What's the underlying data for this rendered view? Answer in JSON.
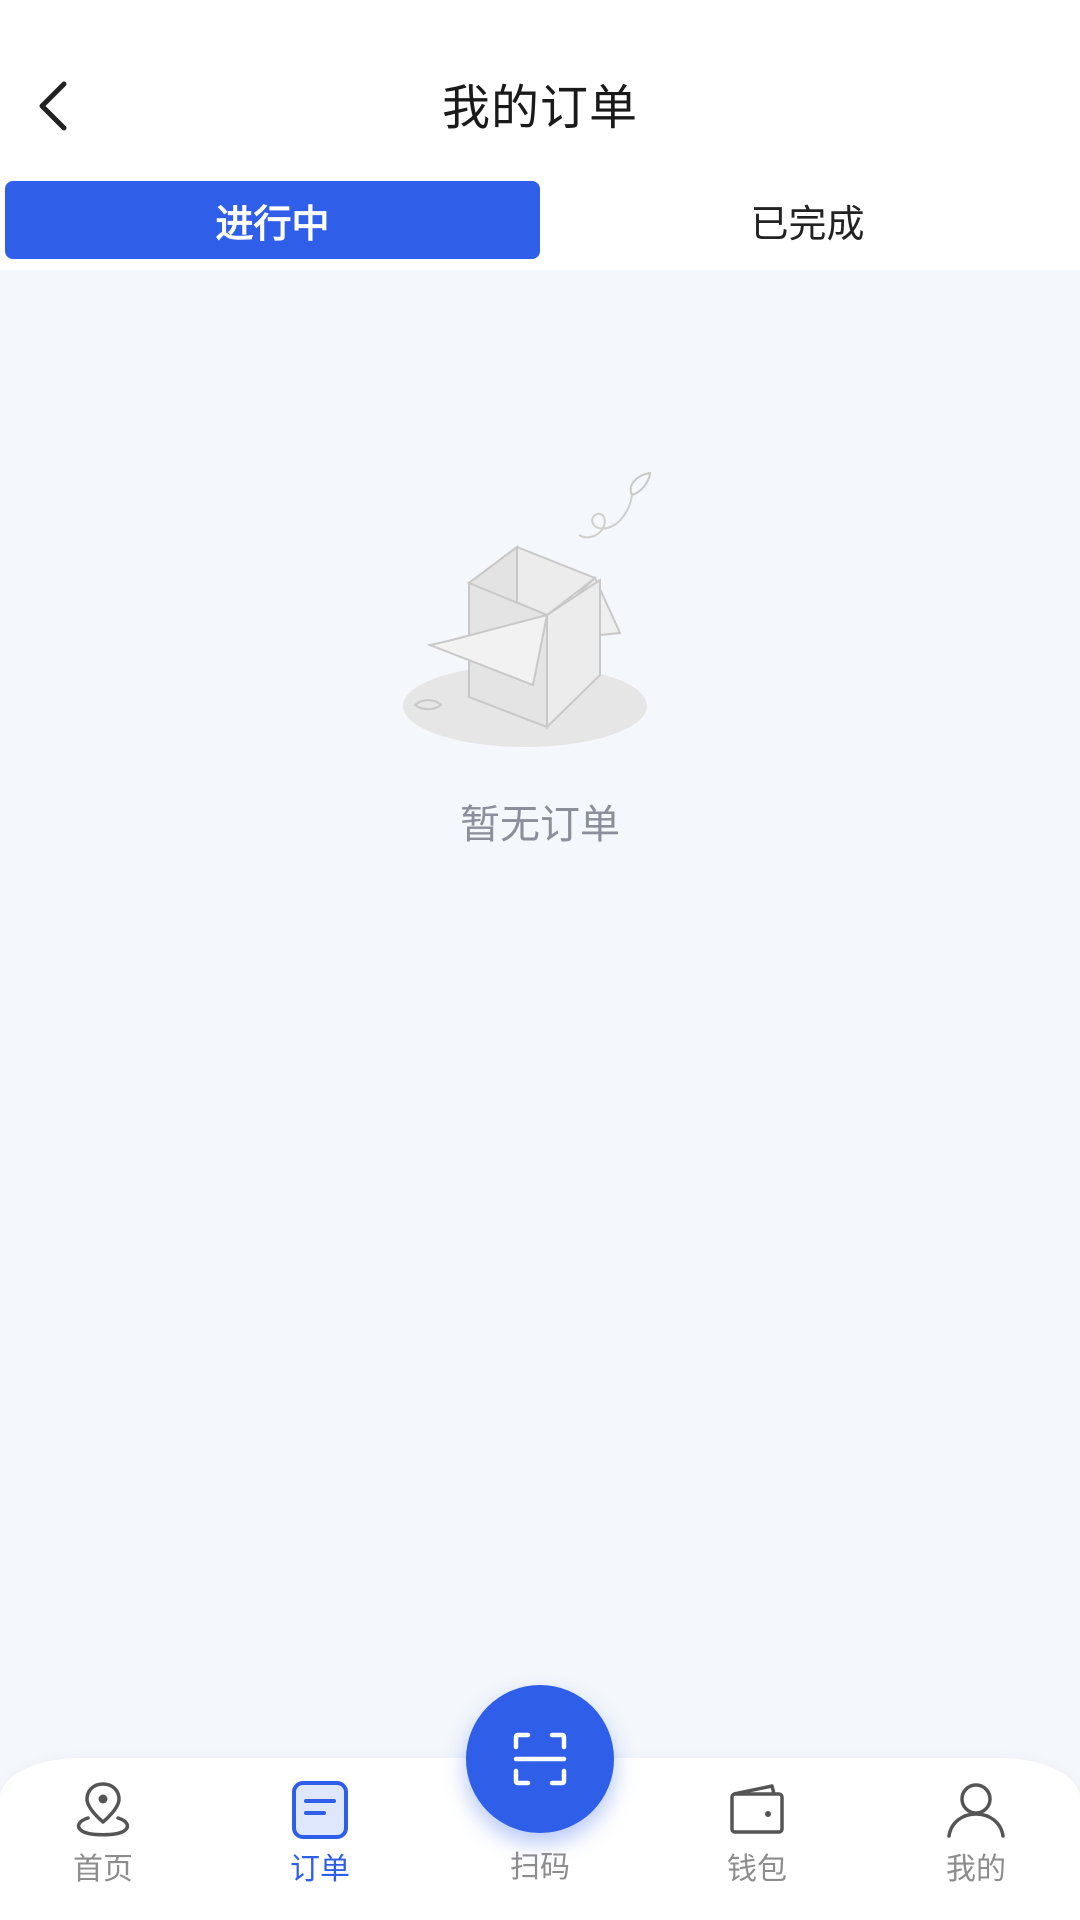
{
  "header": {
    "title": "我的订单"
  },
  "tabs": [
    {
      "label": "进行中",
      "active": true
    },
    {
      "label": "已完成",
      "active": false
    }
  ],
  "empty_state": {
    "text": "暂无订单"
  },
  "bottom_nav": {
    "items": [
      {
        "label": "首页",
        "icon": "location-pin-icon",
        "active": false
      },
      {
        "label": "订单",
        "icon": "order-list-icon",
        "active": true
      },
      {
        "label": "扫码",
        "icon": "scan-icon",
        "active": false
      },
      {
        "label": "钱包",
        "icon": "wallet-icon",
        "active": false
      },
      {
        "label": "我的",
        "icon": "user-icon",
        "active": false
      }
    ]
  },
  "colors": {
    "accent": "#2f5fe8",
    "background": "#f4f7fb",
    "inactive_text": "#8d8d8d"
  }
}
